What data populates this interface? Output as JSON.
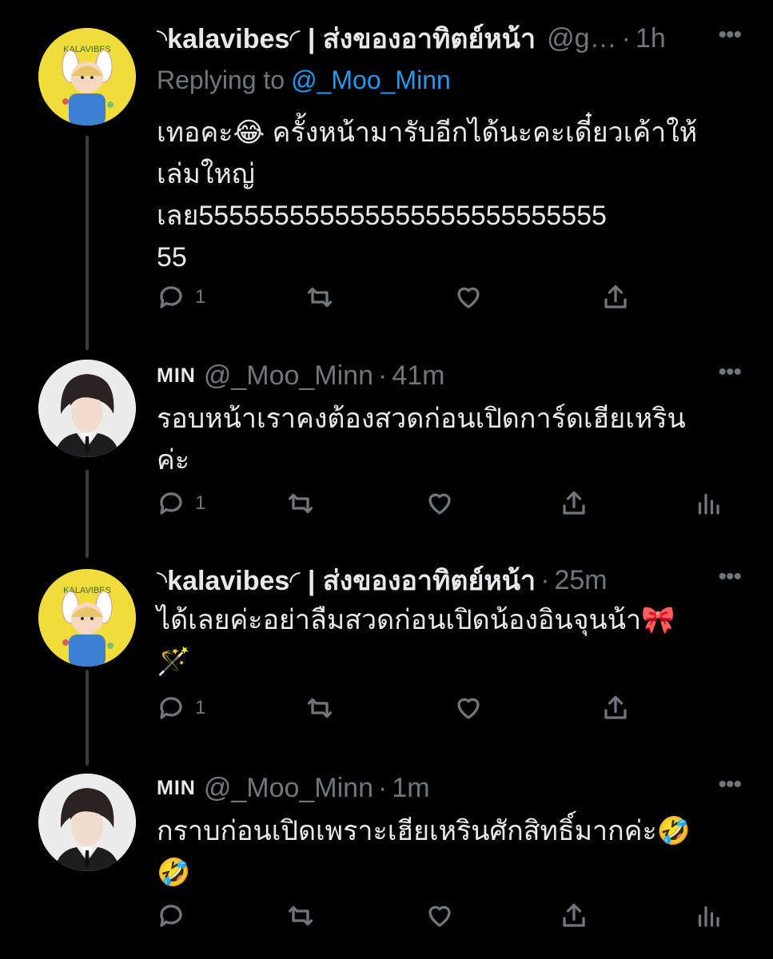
{
  "tweets": [
    {
      "name": "◝kalavibes◜ | ส่งของอาทิตย์หน้า",
      "handle": "@g…",
      "time": "1h",
      "replying_label": "Replying to",
      "replying_handle": "@_Moo_Minn",
      "text_line1": "เทอคะ😂 ครั้งหน้ามารับอีกได้นะคะเดี๋ยวเค้าให้",
      "text_line2": "เล่มใหญ่",
      "text_line3": "เลย555555555555555555555555555",
      "text_line4": "55",
      "reply_count": "1",
      "avatar_text": "KALAVIBES"
    },
    {
      "name": "MIN",
      "handle": "@_Moo_Minn",
      "time": "41m",
      "text_line1": "รอบหน้าเราคงต้องสวดก่อนเปิดการ์ดเฮียเหริน",
      "text_line2": "ค่ะ",
      "reply_count": "1"
    },
    {
      "name": "◝kalavibes◜ | ส่งของอาทิตย์หน้า",
      "time": "25m",
      "text_line1": "ได้เลยค่ะอย่าลืมสวดก่อนเปิดน้องอินจุนน้า🎀",
      "text_line2": "🪄",
      "reply_count": "1",
      "avatar_text": "KALAVIBES"
    },
    {
      "name": "MIN",
      "handle": "@_Moo_Minn",
      "time": "1m",
      "text_line1": "กราบก่อนเปิดเพราะเฮียเหรินศักสิทธิ์มากค่ะ🤣",
      "text_line2": "🤣"
    }
  ],
  "ui": {
    "more_glyph": "•••",
    "dot": "·"
  }
}
